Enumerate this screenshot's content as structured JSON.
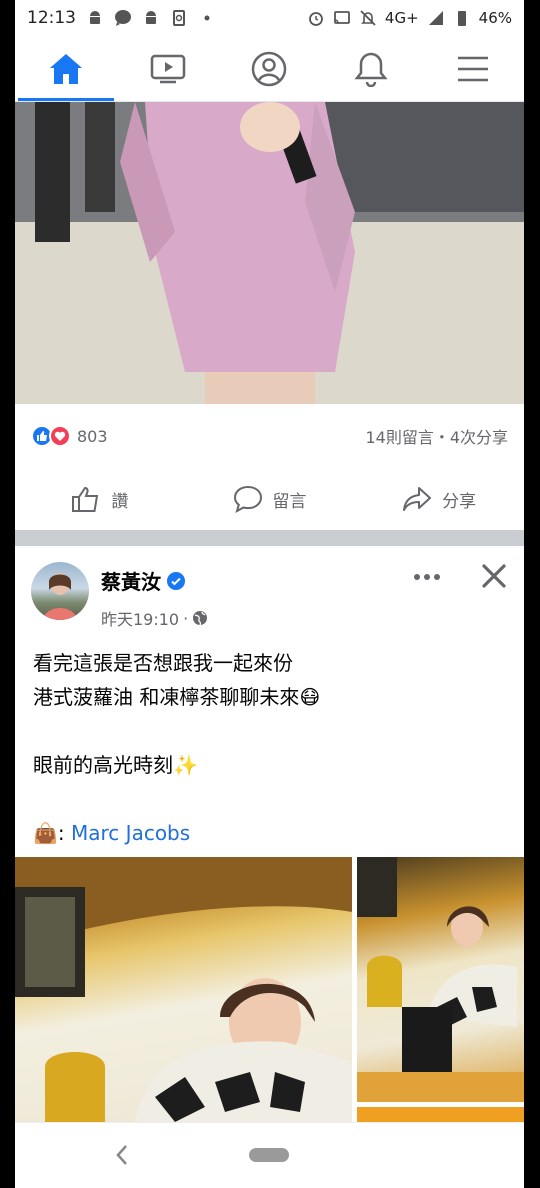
{
  "status_bar": {
    "time": "12:13",
    "network": "4G+",
    "battery": "46%"
  },
  "nav": {
    "tabs": [
      "home-tab",
      "watch-tab",
      "profile-tab",
      "notifications-tab",
      "menu-tab"
    ],
    "active_color": "#1877f2"
  },
  "post1": {
    "reaction_count": "803",
    "stats": "14則留言・4次分享",
    "actions": {
      "like": "讚",
      "comment": "留言",
      "share": "分享"
    }
  },
  "post2": {
    "author": "蔡黃汝",
    "time": "昨天19:10",
    "text": {
      "line1": "看完這張是否想跟我一起來份",
      "line2": "港式菠蘿油 和凍檸茶聊聊未來",
      "line3": "眼前的高光時刻",
      "brand_prefix": ":",
      "brand": "Marc Jacobs"
    },
    "emoji": {
      "line2": "😷",
      "line3": "✨",
      "bag": "👜"
    }
  }
}
